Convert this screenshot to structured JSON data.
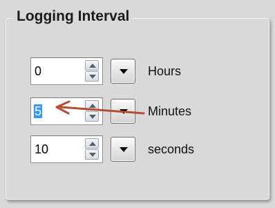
{
  "group": {
    "title": "Logging Interval"
  },
  "rows": [
    {
      "value": "0",
      "unit": "Hours",
      "selected": false
    },
    {
      "value": "5",
      "unit": "Minutes",
      "selected": true
    },
    {
      "value": "10",
      "unit": "seconds",
      "selected": false
    }
  ],
  "icons": {
    "spin_up": "triangle-up-icon",
    "spin_down": "triangle-down-icon",
    "dropdown": "caret-down-icon"
  },
  "colors": {
    "panel": "#d9d9d9",
    "selection": "#3399ff",
    "annotation_arrow": "#b94a34"
  }
}
